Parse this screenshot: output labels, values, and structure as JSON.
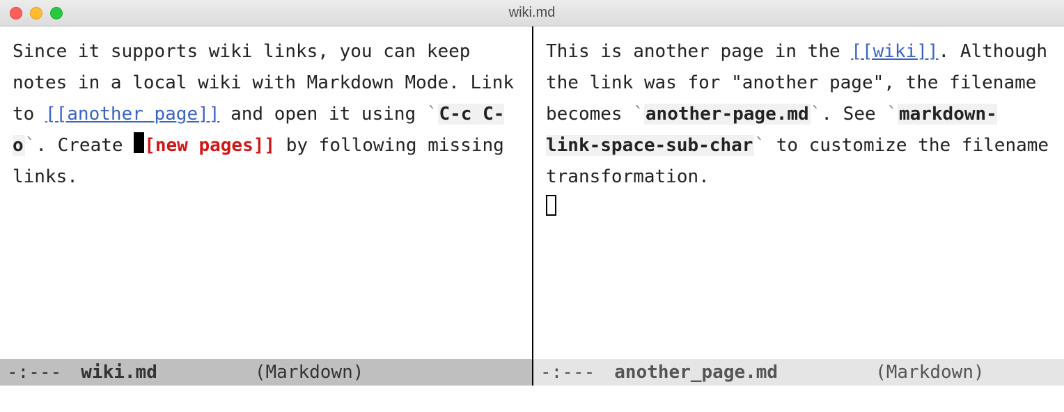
{
  "window": {
    "title": "wiki.md"
  },
  "left": {
    "text": {
      "s0": "Since it supports wiki links, you can keep notes in a local wiki with Markdown Mode.  Link to ",
      "link1": "[[another page]]",
      "s1": " and open it using ",
      "bt": "`",
      "code1": "C-c C-o",
      "s2": ".  Create ",
      "link2_after_cursor": "[new pages]]",
      "s3": " by following missing links."
    },
    "modeline": {
      "status": "-:---",
      "filename": "wiki.md",
      "mode": "(Markdown)"
    }
  },
  "right": {
    "text": {
      "s0": "This is another page in the ",
      "link1": "[[wiki]]",
      "s1": ".  Although the link was for \"another page\", the filename becomes ",
      "bt": "`",
      "code1": "another-page.md",
      "s2": ".  See ",
      "code2": "markdown-link-space-sub-char",
      "s3": " to customize the filename transformation."
    },
    "modeline": {
      "status": "-:---",
      "filename": "another_page.md",
      "mode": "(Markdown)"
    }
  }
}
